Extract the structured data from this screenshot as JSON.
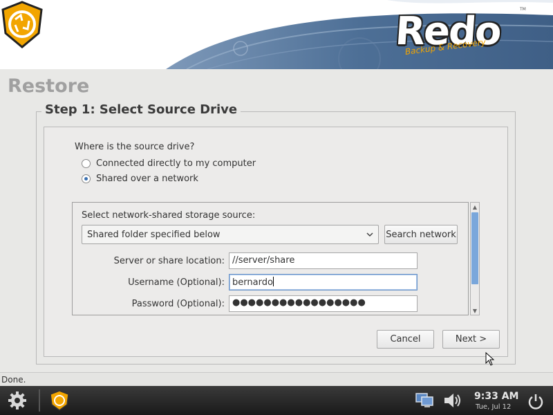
{
  "brand": {
    "name": "Redo",
    "tagline": "Backup & Recovery",
    "trademark": "TM",
    "accent_color": "#f2a500",
    "banner_color": "#4d6f96"
  },
  "page": {
    "title": "Restore"
  },
  "step": {
    "title": "Step 1: Select Source Drive",
    "question": "Where is the source drive?",
    "options": [
      {
        "label": "Connected directly to my computer",
        "selected": false
      },
      {
        "label": "Shared over a network",
        "selected": true
      }
    ]
  },
  "network": {
    "label": "Select network-shared storage source:",
    "source_select": {
      "value": "Shared folder specified below",
      "icon": "chevron-down-icon"
    },
    "search_button": "Search network",
    "fields": {
      "server": {
        "label": "Server or share location:",
        "value": "//server/share"
      },
      "username": {
        "label": "Username (Optional):",
        "value": "bernardo"
      },
      "password": {
        "label": "Password (Optional):",
        "value": "●●●●●●●●●●●●●●●●●"
      }
    }
  },
  "buttons": {
    "cancel": "Cancel",
    "next": "Next >"
  },
  "status": {
    "text": "Done."
  },
  "taskbar": {
    "settings_icon": "gear-icon",
    "app_icon": "redo-logo-icon",
    "network_icon": "network-monitor-icon",
    "volume_icon": "speaker-icon",
    "power_icon": "power-icon",
    "time": "9:33 AM",
    "date": "Tue, Jul 12"
  }
}
